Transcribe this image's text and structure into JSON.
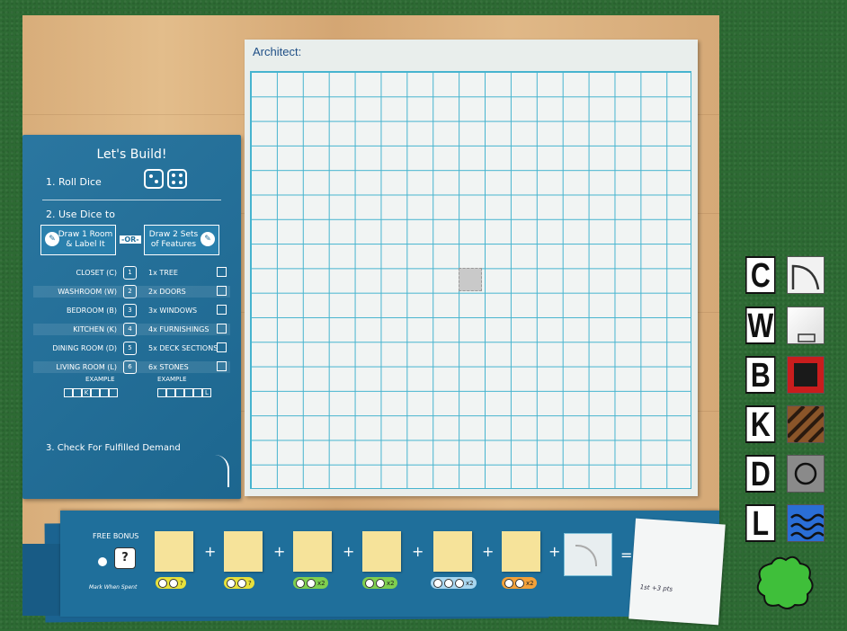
{
  "card": {
    "title": "Let's Build!",
    "step1": "1. Roll Dice",
    "step2": "2. Use Dice to",
    "option1": "Draw 1 Room & Label It",
    "or": "-OR-",
    "option2": "Draw 2 Sets of Features",
    "rows": [
      {
        "room": "CLOSET (C)",
        "feature": "1x TREE",
        "die": "1"
      },
      {
        "room": "WASHROOM (W)",
        "feature": "2x DOORS",
        "die": "2"
      },
      {
        "room": "BEDROOM (B)",
        "feature": "3x WINDOWS",
        "die": "3"
      },
      {
        "room": "KITCHEN (K)",
        "feature": "4x FURNISHINGS",
        "die": "4"
      },
      {
        "room": "DINING ROOM (D)",
        "feature": "5x DECK SECTIONS",
        "die": "5"
      },
      {
        "room": "LIVING ROOM (L)",
        "feature": "6x STONES",
        "die": "6"
      }
    ],
    "example": "EXAMPLE",
    "step3": "3. Check For Fulfilled Demand"
  },
  "sheet": {
    "label": "Architect:"
  },
  "bonus": {
    "label": "FREE BONUS",
    "mark_note": "Mark When Spent",
    "question": "?",
    "chips": [
      "?",
      "?",
      "x2",
      "x2",
      "x2",
      "x2"
    ],
    "score": "1st +3 pts"
  },
  "legend": [
    {
      "letter": "C",
      "icon": "tree-corner-icon"
    },
    {
      "letter": "W",
      "icon": "washroom-tile-icon"
    },
    {
      "letter": "B",
      "icon": "bedroom-tile-icon"
    },
    {
      "letter": "K",
      "icon": "kitchen-tile-icon"
    },
    {
      "letter": "D",
      "icon": "dining-circle-icon"
    },
    {
      "letter": "L",
      "icon": "water-waves-icon"
    }
  ],
  "colors": {
    "felt": "#2d6a33",
    "card_blue": "#1f6f9b",
    "grid_line": "#46b4cf",
    "note_yellow": "#f6e39a",
    "blob_green": "#3fbf3a"
  }
}
